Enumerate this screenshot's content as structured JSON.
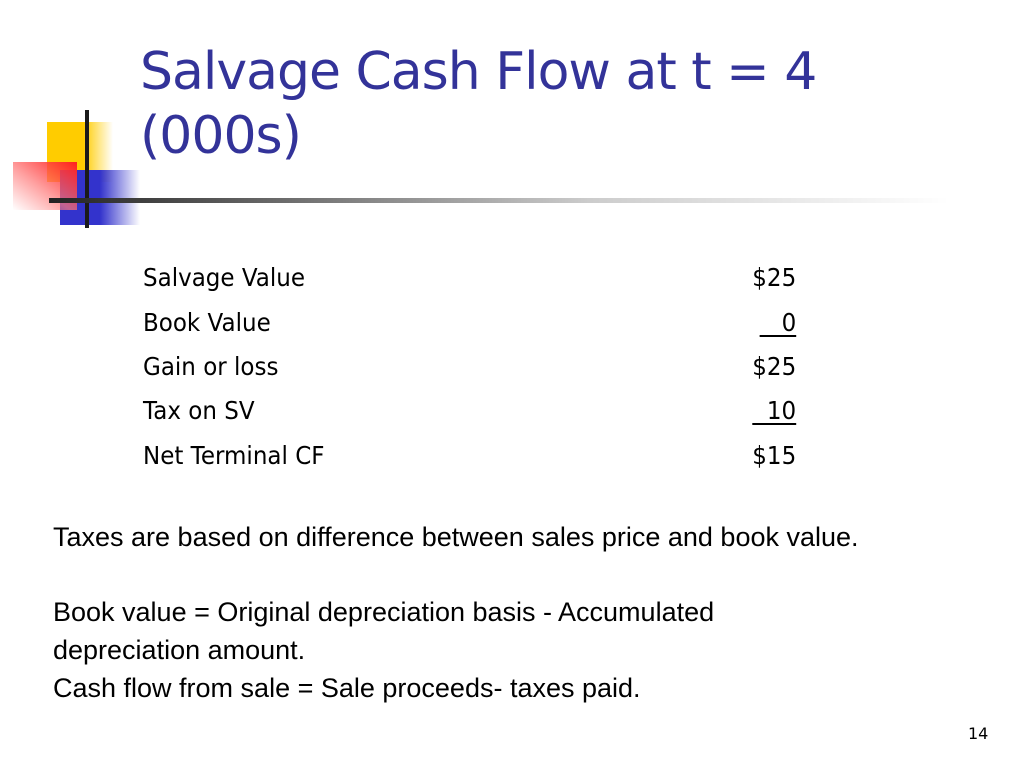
{
  "slide": {
    "title_line1": "Salvage Cash Flow at t = 4",
    "title_line2": "(000s)",
    "table": [
      {
        "label": "Salvage Value",
        "value": "$25",
        "underline": false
      },
      {
        "label": "Book Value",
        "value": "   0",
        "underline": true
      },
      {
        "label": "Gain or loss",
        "value": "$25",
        "underline": false
      },
      {
        "label": "Tax on SV",
        "value": "  10",
        "underline": true
      },
      {
        "label": "Net Terminal CF",
        "value": "$15",
        "underline": false
      }
    ],
    "note1": "Taxes are based on difference between sales price and book value.",
    "note2_line1": "Book value = Original depreciation basis - Accumulated",
    "note2_line2": "depreciation amount.",
    "note3": "Cash flow from sale = Sale proceeds- taxes paid.",
    "page_number": "14"
  },
  "colors": {
    "title": "#333399",
    "accent_yellow": "#ffcc00",
    "accent_blue": "#3333cc",
    "accent_red": "#ff2020"
  }
}
